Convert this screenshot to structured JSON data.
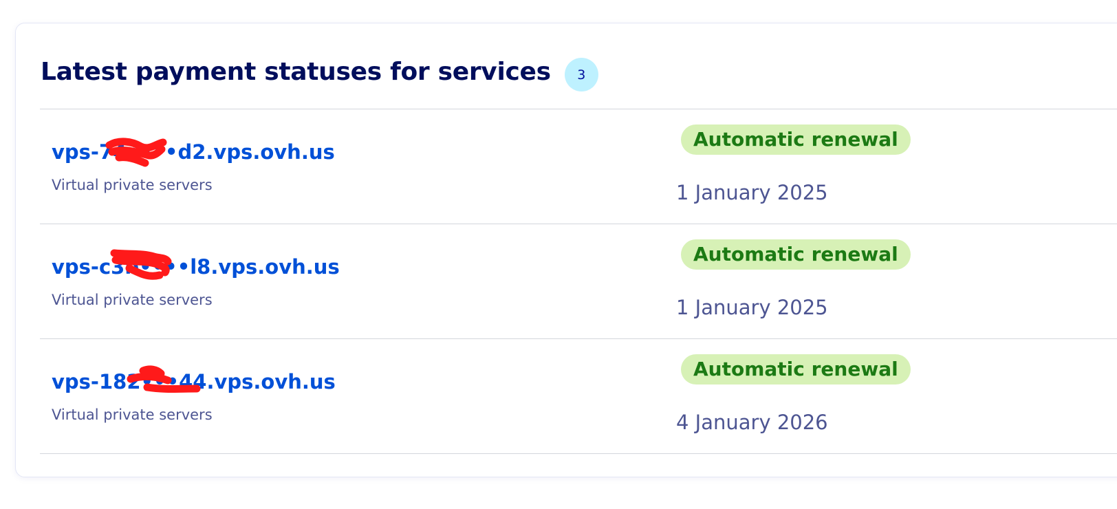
{
  "card": {
    "title": "Latest payment statuses for services",
    "count": "3"
  },
  "services": [
    {
      "name": "vps-74••••d2.vps.ovh.us",
      "type": "Virtual private servers",
      "status": "Automatic renewal",
      "date": "1 January 2025"
    },
    {
      "name": "vps-c3b••••l8.vps.ovh.us",
      "type": "Virtual private servers",
      "status": "Automatic renewal",
      "date": "1 January 2025"
    },
    {
      "name": "vps-182•••44.vps.ovh.us",
      "type": "Virtual private servers",
      "status": "Automatic renewal",
      "date": "4 January 2026"
    }
  ],
  "colors": {
    "title": "#000e5c",
    "link": "#0050d7",
    "status_bg": "#d7f1b6",
    "status_text": "#1c7a14",
    "badge_bg": "#bef1ff",
    "redaction": "#ff1a1a"
  }
}
